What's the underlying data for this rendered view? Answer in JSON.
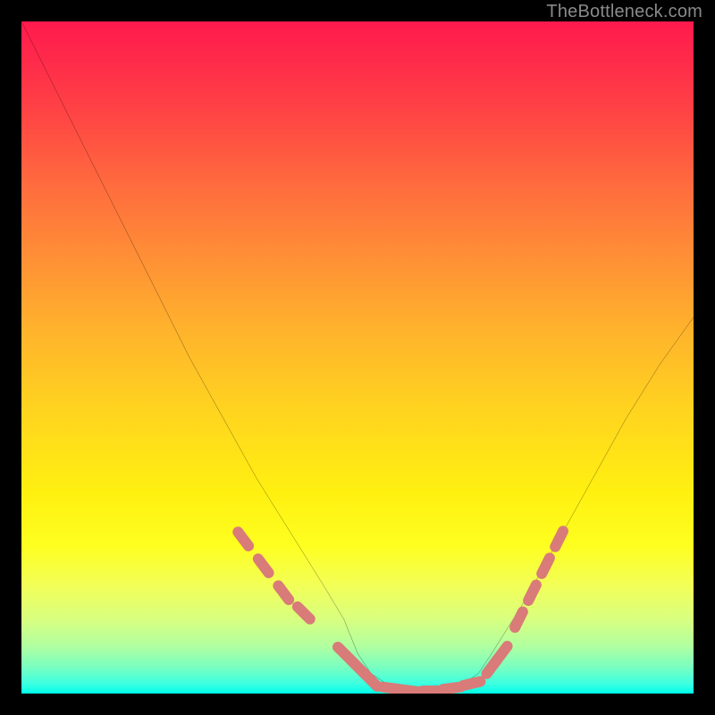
{
  "watermark": "TheBottleneck.com",
  "chart_data": {
    "type": "line",
    "title": "",
    "xlabel": "",
    "ylabel": "",
    "xlim": [
      0,
      100
    ],
    "ylim": [
      0,
      100
    ],
    "grid": false,
    "legend": false,
    "series": [
      {
        "name": "bottleneck-curve",
        "x": [
          0,
          5,
          10,
          15,
          20,
          25,
          30,
          35,
          40,
          45,
          48,
          50,
          52,
          55,
          58,
          62,
          65,
          68,
          70,
          75,
          80,
          85,
          90,
          95,
          100
        ],
        "y": [
          100,
          90,
          80,
          70,
          60,
          50,
          41,
          32,
          24,
          16,
          11,
          6,
          3,
          1,
          0,
          0,
          1,
          3,
          6,
          14,
          23,
          32,
          41,
          49,
          56
        ]
      }
    ],
    "markers": {
      "name": "highlighted-points",
      "color": "#d97b78",
      "segments": [
        {
          "x": [
            33,
            36,
            39,
            42
          ],
          "y": [
            23,
            19,
            15,
            12
          ]
        },
        {
          "x": [
            48,
            50,
            52
          ],
          "y": [
            6,
            4,
            2
          ]
        },
        {
          "x": [
            55,
            58,
            61,
            64,
            67
          ],
          "y": [
            0.8,
            0.4,
            0.4,
            0.8,
            1.5
          ]
        },
        {
          "x": [
            70,
            71.5
          ],
          "y": [
            4,
            6
          ]
        },
        {
          "x": [
            74,
            76,
            78,
            80
          ],
          "y": [
            11,
            15,
            19,
            23
          ]
        }
      ]
    },
    "background_gradient": {
      "stops": [
        {
          "pos": 0.0,
          "color": "#ff1a4d"
        },
        {
          "pos": 0.5,
          "color": "#ffc820"
        },
        {
          "pos": 0.75,
          "color": "#fff010"
        },
        {
          "pos": 1.0,
          "color": "#00ffe8"
        }
      ]
    }
  }
}
